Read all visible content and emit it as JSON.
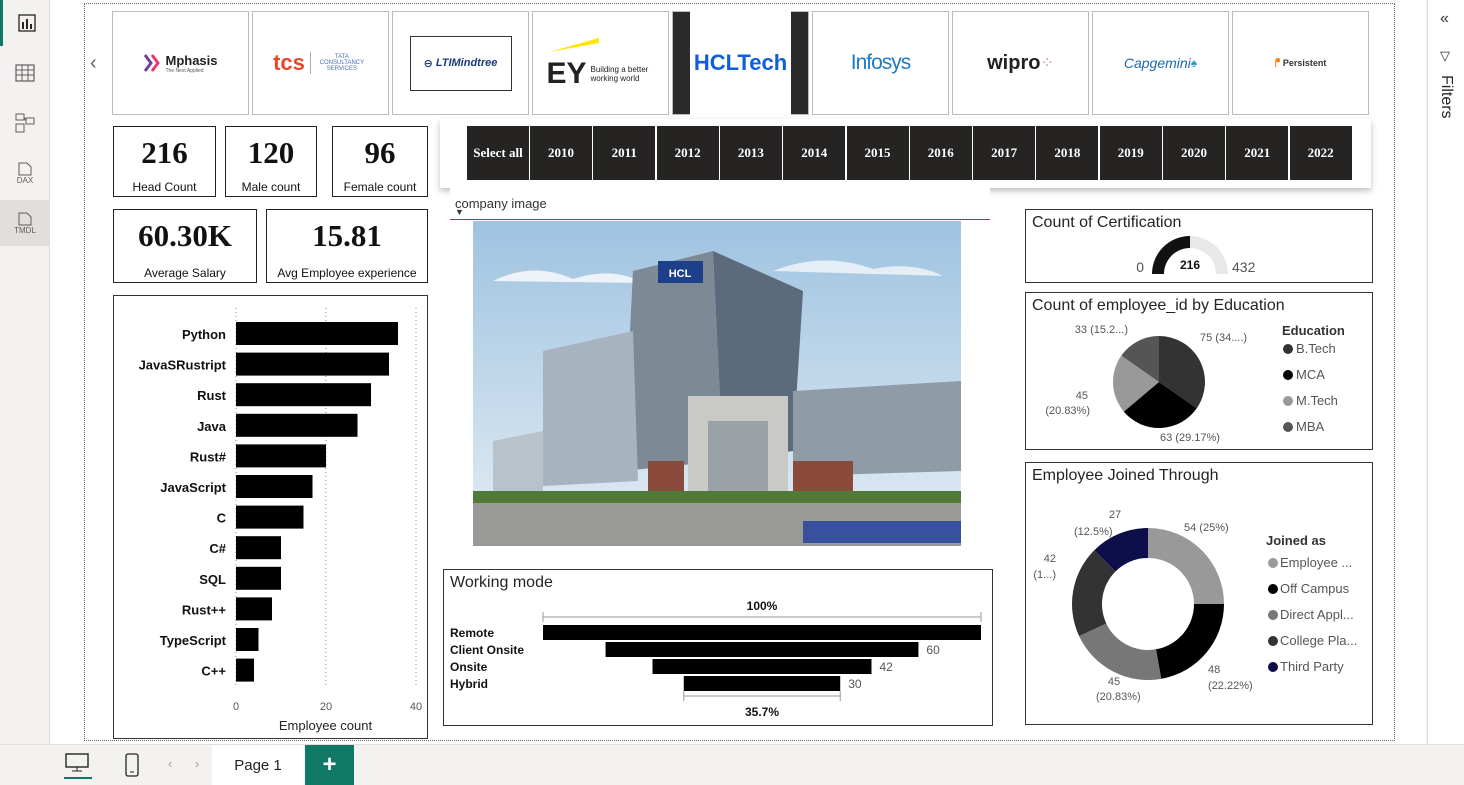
{
  "leftbar": {
    "icons": [
      "report-view-icon",
      "table-view-icon",
      "model-view-icon",
      "dax-query-icon",
      "tmdl-view-icon"
    ],
    "dax_label": "DAX",
    "tmdl_label": "TMDL"
  },
  "logos": [
    "Mphasis",
    "The Next Applied",
    "tcs",
    "TATA CONSULTANCY SERVICES",
    "LTIMindtree",
    "EY",
    "Building a better working world",
    "HCLTech",
    "Infosys",
    "wipro",
    "Capgemini",
    "Persistent"
  ],
  "kpis": [
    {
      "value": "216",
      "label": "Head Count"
    },
    {
      "value": "120",
      "label": "Male count"
    },
    {
      "value": "96",
      "label": "Female count"
    },
    {
      "value": "60.30K",
      "label": "Average Salary"
    },
    {
      "value": "15.81",
      "label": "Avg Employee experience"
    }
  ],
  "years": {
    "select_all": "Select all",
    "items": [
      "2010",
      "2011",
      "2012",
      "2013",
      "2014",
      "2015",
      "2016",
      "2017",
      "2018",
      "2019",
      "2020",
      "2021",
      "2022"
    ]
  },
  "company_image": {
    "label": "company image",
    "building_sign": "HCL"
  },
  "skills_chart": {
    "xlabel": "Employee count",
    "ticks": [
      "0",
      "20",
      "40"
    ]
  },
  "chart_data": [
    {
      "type": "bar",
      "orientation": "horizontal",
      "categories": [
        "Python",
        "JavaSRustript",
        "Rust",
        "Java",
        "Rust#",
        "JavaScript",
        "C",
        "C#",
        "SQL",
        "Rust++",
        "TypeScript",
        "C++"
      ],
      "values": [
        36,
        34,
        30,
        27,
        20,
        17,
        15,
        10,
        10,
        8,
        5,
        4
      ],
      "xlabel": "Employee count",
      "xlim": [
        0,
        40
      ],
      "grid": "vertical dotted"
    },
    {
      "type": "gauge",
      "title": "Count of Certification",
      "min": 0,
      "max": 432,
      "value": 216,
      "min_label": "0",
      "max_label": "432",
      "value_label": "216"
    },
    {
      "type": "pie",
      "title": "Count of employee_id by Education",
      "legend_title": "Education",
      "categories": [
        "B.Tech",
        "MCA",
        "M.Tech",
        "MBA"
      ],
      "values": [
        75,
        63,
        45,
        33
      ],
      "labels": [
        "75 (34....)",
        "63 (29.17%)",
        "45",
        "(20.83%)",
        "33 (15.2...)"
      ],
      "colors": [
        "#333333",
        "#000000",
        "#999999",
        "#555555"
      ]
    },
    {
      "type": "donut",
      "title": "Employee Joined Through",
      "legend_title": "Joined as",
      "categories": [
        "Employee ...",
        "Off Campus",
        "Direct Appl...",
        "College Pla...",
        "Third Party"
      ],
      "values": [
        54,
        48,
        45,
        42,
        27
      ],
      "labels": [
        "54 (25%)",
        "48",
        "(22.22%)",
        "45",
        "(20.83%)",
        "42",
        "(1...)",
        "27",
        "(12.5%)"
      ],
      "colors": [
        "#999999",
        "#000000",
        "#777777",
        "#333333",
        "#0d0e4a"
      ]
    },
    {
      "type": "funnel",
      "title": "Working mode",
      "categories": [
        "Remote",
        "Client Onsite",
        "Onsite",
        "Hybrid"
      ],
      "values": [
        84,
        60,
        42,
        30
      ],
      "value_labels": [
        "",
        "60",
        "42",
        "30"
      ],
      "top_label": "100%",
      "bottom_label": "35.7%"
    }
  ],
  "rightpane": {
    "title": "Filters"
  },
  "bottombar": {
    "page_tab": "Page 1",
    "add": "+"
  }
}
